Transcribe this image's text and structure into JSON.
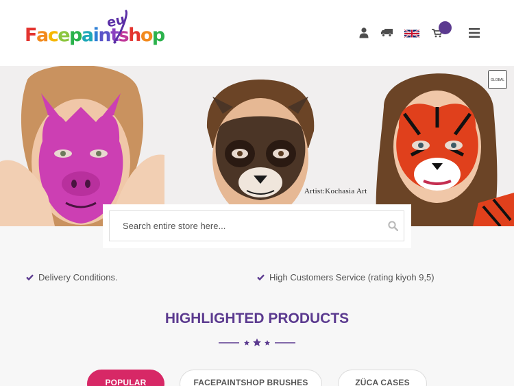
{
  "header": {
    "logo": {
      "letters": [
        "F",
        "a",
        "c",
        "e",
        "p",
        "a",
        "i",
        "n",
        "t",
        "s",
        "h",
        "o",
        "p"
      ],
      "letter_colors": [
        "#e3342f",
        "#f28a1e",
        "#f6b700",
        "#8cc63f",
        "#2bb24c",
        "#1ea8b8",
        "#2c7fd6",
        "#5a55c8",
        "#8a3fc0",
        "#c0399a",
        "#e3342f",
        "#f28a1e",
        "#2bb24c"
      ],
      "suffix": "eu"
    },
    "icons": [
      "user-icon",
      "truck-icon",
      "uk-flag-icon",
      "cart-icon",
      "hamburger-menu-icon"
    ],
    "accent": "#5b3a8f"
  },
  "hero": {
    "artist_credit": "Artist:Kochasia Art",
    "badge_text": "GLOBAL"
  },
  "search": {
    "placeholder": "Search entire store here..."
  },
  "features": [
    {
      "label": "Delivery Conditions."
    },
    {
      "label": "High Customers Service (rating kiyoh 9,5)"
    }
  ],
  "highlighted": {
    "title": "HIGHLIGHTED PRODUCTS"
  },
  "tabs": [
    {
      "label": "POPULAR",
      "active": true
    },
    {
      "label": "FACEPAINTSHOP BRUSHES",
      "active": false
    },
    {
      "label": "ZÜCA CASES",
      "active": false
    }
  ],
  "colors": {
    "brand_purple": "#5b3a8f",
    "active_tab": "#d72866"
  }
}
